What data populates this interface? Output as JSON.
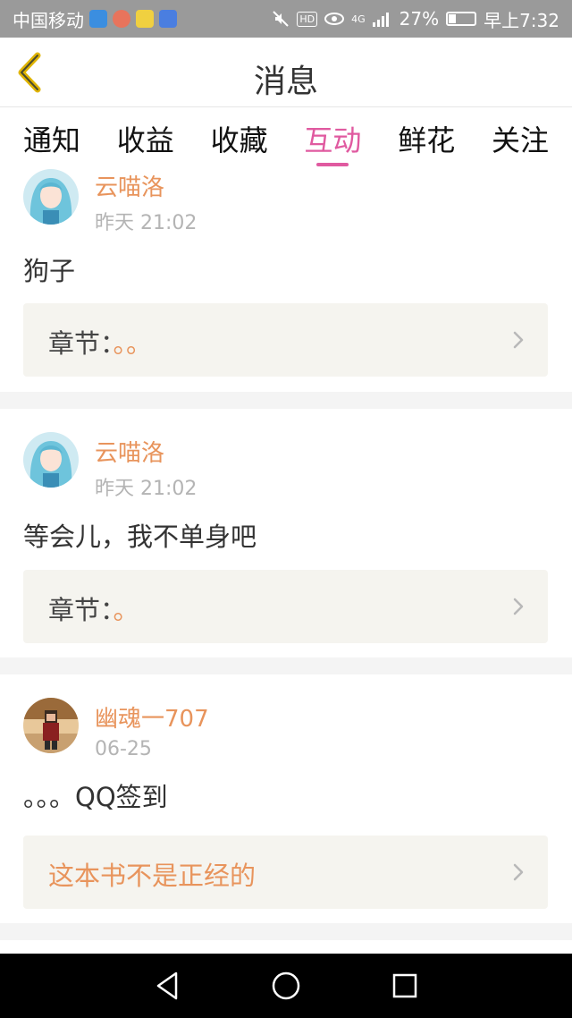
{
  "status_bar": {
    "carrier": "中国移动",
    "hd": "HD",
    "network": "4G",
    "battery": "27%",
    "battery_level": 0.27,
    "time": "早上7:32"
  },
  "header": {
    "title": "消息"
  },
  "tabs": [
    {
      "label": "通知",
      "active": false
    },
    {
      "label": "收益",
      "active": false
    },
    {
      "label": "收藏",
      "active": false
    },
    {
      "label": "互动",
      "active": true
    },
    {
      "label": "鲜花",
      "active": false
    },
    {
      "label": "关注",
      "active": false
    }
  ],
  "posts": [
    {
      "user": "云喵洛",
      "time": "昨天 21:02",
      "text": "狗子",
      "chapter_label": "章节：",
      "chapter_value": "。。"
    },
    {
      "user": "云喵洛",
      "time": "昨天 21:02",
      "text": "等会儿，我不单身吧",
      "chapter_label": "章节：",
      "chapter_value": "。"
    },
    {
      "user": "幽魂一707",
      "time": "06-25",
      "text": "。。。QQ签到",
      "book_title": "这本书不是正经的"
    }
  ],
  "colors": {
    "accent_pink": "#e05aa0",
    "accent_orange": "#e8945c",
    "back_arrow": "#e0b400",
    "status_bar": "#9a9a9a"
  },
  "icons": {
    "back": "chevron-left-icon",
    "chevron": "chevron-right-icon",
    "nav_back": "triangle-back-icon",
    "nav_home": "circle-home-icon",
    "nav_recent": "square-recent-icon"
  }
}
